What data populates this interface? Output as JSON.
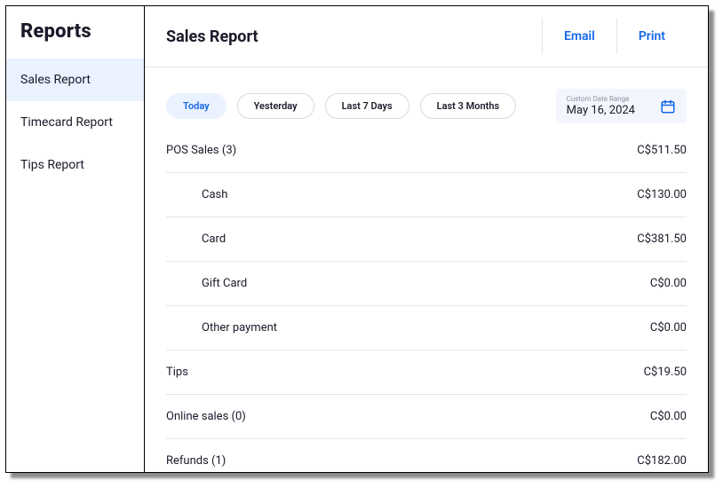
{
  "sidebar": {
    "title": "Reports",
    "items": [
      {
        "label": "Sales Report",
        "active": true
      },
      {
        "label": "Timecard Report",
        "active": false
      },
      {
        "label": "Tips Report",
        "active": false
      }
    ]
  },
  "header": {
    "title": "Sales Report",
    "email_label": "Email",
    "print_label": "Print"
  },
  "filters": {
    "options": [
      {
        "label": "Today",
        "active": true
      },
      {
        "label": "Yesterday",
        "active": false
      },
      {
        "label": "Last 7 Days",
        "active": false
      },
      {
        "label": "Last 3 Months",
        "active": false
      }
    ],
    "custom_label": "Custom Date Range",
    "custom_value": "May 16, 2024"
  },
  "rows": {
    "pos_sales": {
      "label": "POS Sales (3)",
      "amount": "C$511.50"
    },
    "cash": {
      "label": "Cash",
      "amount": "C$130.00"
    },
    "card": {
      "label": "Card",
      "amount": "C$381.50"
    },
    "gift_card": {
      "label": "Gift Card",
      "amount": "C$0.00"
    },
    "other_payment": {
      "label": "Other payment",
      "amount": "C$0.00"
    },
    "tips": {
      "label": "Tips",
      "amount": "C$19.50"
    },
    "online_sales": {
      "label": "Online sales (0)",
      "amount": "C$0.00"
    },
    "refunds": {
      "label": "Refunds (1)",
      "amount": "C$182.00"
    }
  }
}
